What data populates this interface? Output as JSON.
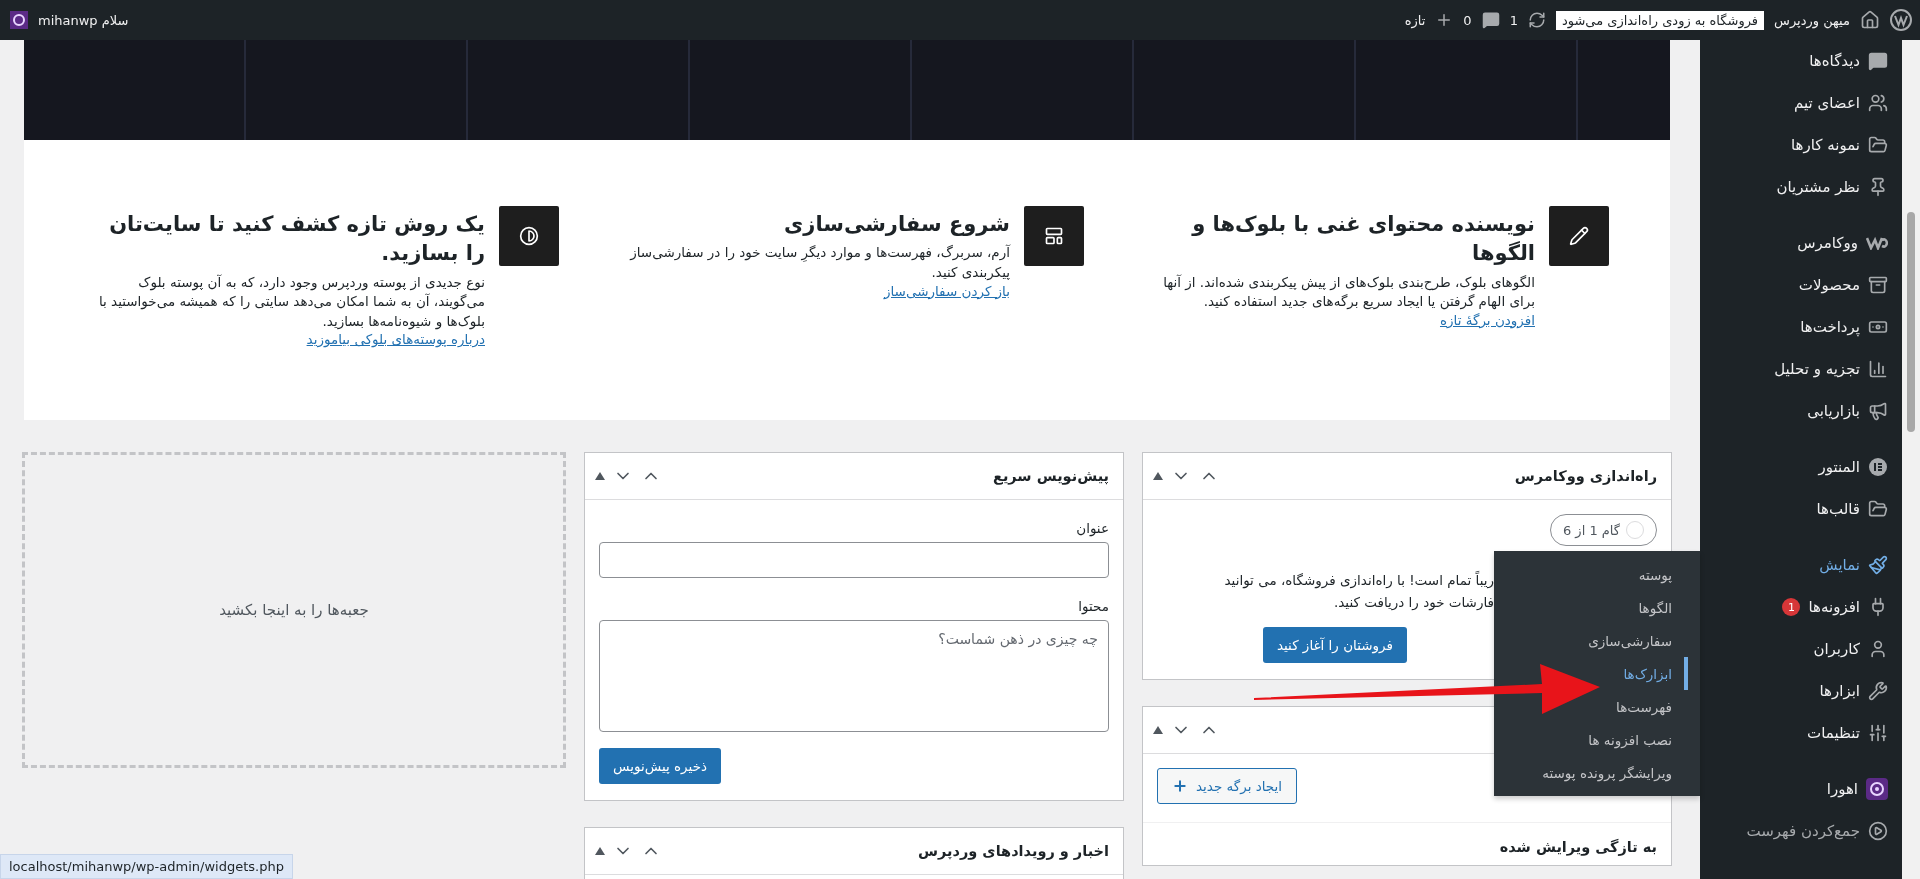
{
  "admin_bar": {
    "site_name": "میهن وردپرس",
    "store_badge": "فروشگاه به زودی راه‌اندازی می‌شود",
    "updates": "1",
    "comments": "0",
    "new": "تازه",
    "greeting": "سلام mihanwp"
  },
  "welcome": {
    "columns": [
      {
        "title": "نویسنده محتوای غنی با بلوک‌ها و الگوها",
        "body": "الگوهای بلوک، طرح‌بندی بلوک‌های از پیش پیکربندی شده‌اند. از آنها برای الهام گرفتن یا ایجاد سریع برگه‌های جدید استفاده کنید.",
        "link": "افزودن برگهٔ تازه"
      },
      {
        "title": "شروع سفارشی‌سازی",
        "body": "آرم، سربرگ، فهرست‌ها و موارد دیگرِ سایت خود را در سفارشی‌ساز پیکربندی کنید.",
        "link": "باز کردن سفارشی‌ساز"
      },
      {
        "title": "یک روش تازه کشف کنید تا سایت‌تان را بسازید.",
        "body": "نوع جدیدی از پوسته وردپرس وجود دارد، که به آن پوسته بلوک می‌گویند، آن به شما امکان می‌دهد سایتی را که همیشه می‌خواستید با بلوک‌ها و شیوه‌نامه‌ها بسازید.",
        "link": "درباره پوسته‌های بلوکی بیاموزید"
      }
    ]
  },
  "woo_setup": {
    "title": "راه‌اندازی ووکامرس",
    "step": "گام 1 از 6",
    "text_lines": [
      "ریباً تمام است! با راه‌اندازی فروشگاه، می توانید",
      "فارشات خود را دریافت کنید."
    ],
    "button": "فروشتان را آغاز کنید"
  },
  "pages_box": {
    "button": "ایجاد برگه جدید",
    "recent_title": "به تازگی ویرایش شده"
  },
  "quick_draft": {
    "title": "پیش‌نویس سریع",
    "title_label": "عنوان",
    "content_label": "محتوا",
    "content_placeholder": "چه چیزی در ذهن شماست؟",
    "save": "ذخیره پیش‌نویس"
  },
  "news": {
    "title": "اخبار و رویدادهای وردپرس"
  },
  "dropzone": "جعبه‌ها را به اینجا بکشید",
  "sidebar": {
    "groups": [
      {
        "items": [
          {
            "label": "دیدگاه‌ها",
            "selected": false
          },
          {
            "label": "اعضای تیم",
            "selected": false
          },
          {
            "label": "نمونه کارها",
            "selected": false
          },
          {
            "label": "نظر مشتریان",
            "selected": false
          }
        ]
      },
      {
        "items": [
          {
            "label": "ووکامرس",
            "selected": false
          },
          {
            "label": "محصولات",
            "selected": false
          },
          {
            "label": "پرداخت‌ها",
            "selected": false
          },
          {
            "label": "تجزیه و تحلیل",
            "selected": false
          },
          {
            "label": "بازاریابی",
            "selected": false
          }
        ]
      },
      {
        "items": [
          {
            "label": "المنتور",
            "selected": false
          },
          {
            "label": "قالب‌ها",
            "selected": false
          }
        ]
      },
      {
        "items": [
          {
            "label": "نمایش",
            "selected": true
          },
          {
            "label": "افزونه‌ها",
            "selected": false,
            "badge": "1"
          },
          {
            "label": "کاربران",
            "selected": false
          },
          {
            "label": "ابزارها",
            "selected": false
          },
          {
            "label": "تنظیمات",
            "selected": false
          }
        ]
      },
      {
        "items": [
          {
            "label": "اهورا",
            "selected": false
          },
          {
            "label": "جمع‌کردن فهرست",
            "selected": false,
            "kind": "collapse"
          }
        ]
      }
    ]
  },
  "flyout": [
    {
      "label": "پوسته",
      "selected": false
    },
    {
      "label": "الگوها",
      "selected": false
    },
    {
      "label": "سفارشی‌سازی",
      "selected": false
    },
    {
      "label": "ابزارک‌ها",
      "selected": true
    },
    {
      "label": "فهرست‌ها",
      "selected": false
    },
    {
      "label": "نصب افزونه ها",
      "selected": false
    },
    {
      "label": "ویرایشگر پرونده پوسته",
      "selected": false
    }
  ],
  "status_url": "localhost/mihanwp/wp-admin/widgets.php"
}
